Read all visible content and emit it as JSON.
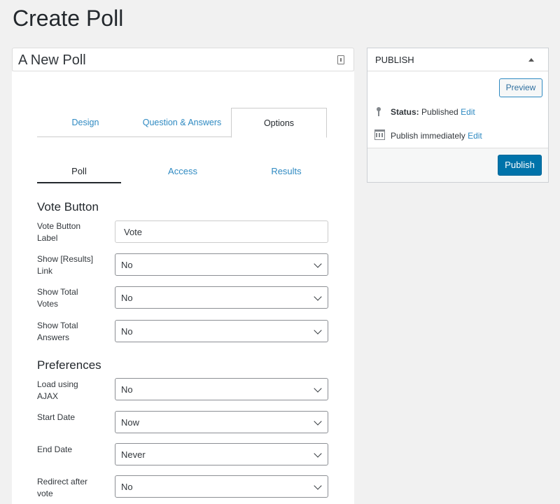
{
  "page": {
    "title": "Create Poll"
  },
  "poll_title": {
    "value": "A New Poll"
  },
  "top_tabs": [
    {
      "label": "Design",
      "active": false
    },
    {
      "label": "Question & Answers",
      "active": false
    },
    {
      "label": "Options",
      "active": true
    }
  ],
  "sub_tabs": [
    {
      "label": "Poll",
      "active": true
    },
    {
      "label": "Access",
      "active": false
    },
    {
      "label": "Results",
      "active": false
    }
  ],
  "vote_button_section": {
    "heading": "Vote Button",
    "fields": [
      {
        "label": "Vote Button Label",
        "type": "text",
        "value": "Vote"
      },
      {
        "label": "Show [Results] Link",
        "type": "select",
        "value": "No"
      },
      {
        "label": "Show Total Votes",
        "type": "select",
        "value": "No"
      },
      {
        "label": "Show Total Answers",
        "type": "select",
        "value": "No"
      }
    ]
  },
  "preferences_section": {
    "heading": "Preferences",
    "fields": [
      {
        "label": "Load using AJAX",
        "type": "select",
        "value": "No"
      },
      {
        "label": "Start Date",
        "type": "select",
        "value": "Now"
      },
      {
        "label": "End Date",
        "type": "select",
        "value": "Never"
      },
      {
        "label": "Redirect after vote",
        "type": "select",
        "value": "No"
      }
    ]
  },
  "publish_box": {
    "title": "PUBLISH",
    "preview_label": "Preview",
    "status_label": "Status:",
    "status_value": "Published",
    "status_edit": "Edit",
    "schedule_text": "Publish immediately",
    "schedule_edit": "Edit",
    "publish_label": "Publish",
    "accent_color": "#0073aa"
  },
  "icons": {
    "title_field": "document-icon",
    "publish_collapse": "triangle-up-icon",
    "status": "pin-icon",
    "schedule": "calendar-icon",
    "select": "chevron-down-icon"
  }
}
